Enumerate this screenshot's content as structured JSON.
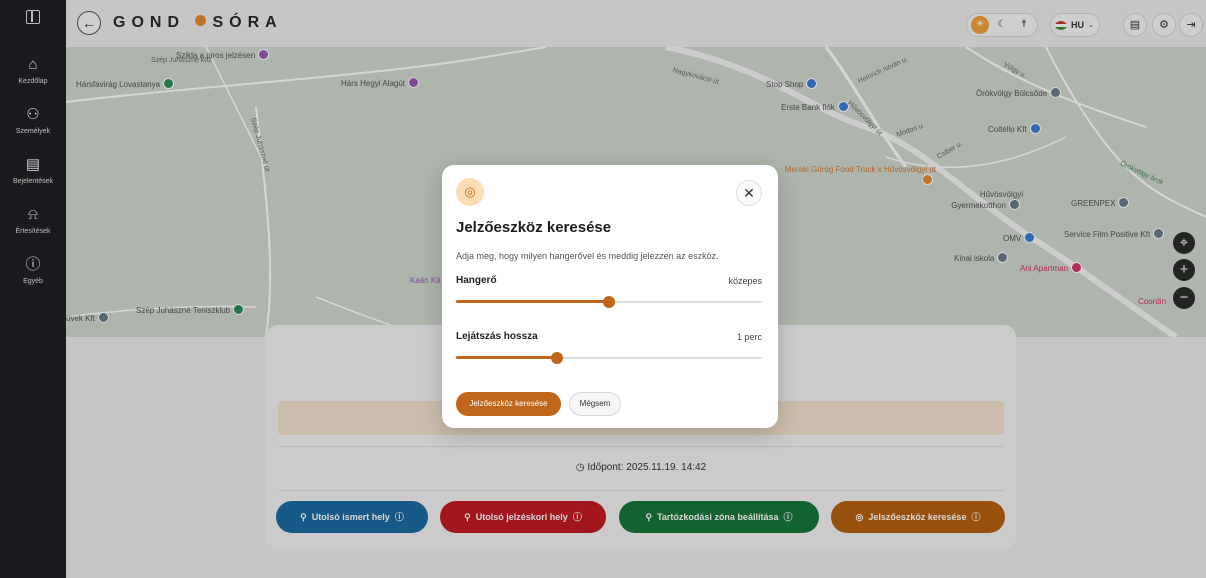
{
  "sidebar": {
    "items": [
      {
        "label": "Kezdőlap",
        "icon": "home-icon"
      },
      {
        "label": "Személyek",
        "icon": "people-icon"
      },
      {
        "label": "Bejelentések",
        "icon": "report-icon"
      },
      {
        "label": "Értesítések",
        "icon": "bell-icon"
      },
      {
        "label": "Egyéb",
        "icon": "info-icon"
      }
    ]
  },
  "header": {
    "logo_left": "GOND",
    "logo_right": "SÓRA",
    "lang": "HU"
  },
  "map": {
    "pois": [
      "Szikla a piros jelzésen",
      "Hárs Hegyi Alagút",
      "Hársfavirág Lovastanya",
      "Stop Shop",
      "Erste Bank fiók",
      "Örökvölgy Bölcsőde",
      "Coltello Kft",
      "Meraki Görög Food Truck x Hűvösvölgyi út",
      "Hűvösvölgyi Gyermekotthon",
      "GREENPEX",
      "OMV",
      "Service Film Positive Kft",
      "Kinai iskola",
      "Ani Apartman",
      "Coordin",
      "Szép Juhászné Teniszklub",
      "üvek Kft",
      "Kaán Ká"
    ],
    "streets": [
      "Szép Juhászné köz",
      "Szép Juhászné út",
      "Nagykovácsi út",
      "Heinrich István u.",
      "Hűvösvölgyi út",
      "Völgy u.",
      "Örökvölgy árok",
      "Modori u.",
      "Csiber u."
    ]
  },
  "modal": {
    "title": "Jelzőeszköz keresése",
    "description": "Adja meg, hogy milyen hangerővel és meddig jelezzen az eszköz.",
    "volume_label": "Hangerő",
    "volume_value": "közepes",
    "volume_level": 0.5,
    "duration_label": "Lejátszás hossza",
    "duration_value": "1 perc",
    "duration_level": 0.33,
    "primary_label": "Jelzőeszköz keresése",
    "secondary_label": "Mégsem"
  },
  "card": {
    "timestamp_label": "Időpont:",
    "timestamp_value": "2025.11.19. 14:42",
    "actions": [
      {
        "label": "Utolsó ismert hely",
        "color": "#1c6aa0"
      },
      {
        "label": "Utolsó jelzéskori hely",
        "color": "#c31c22"
      },
      {
        "label": "Tartózkodási zóna beállítása",
        "color": "#18753a"
      },
      {
        "label": "Jelszőeszköz keresése",
        "color": "#b6610f"
      }
    ]
  },
  "colors": {
    "accent": "#c0661a",
    "logo_dot": "#ea8a2e",
    "sidebar_bg": "#1f2124"
  }
}
